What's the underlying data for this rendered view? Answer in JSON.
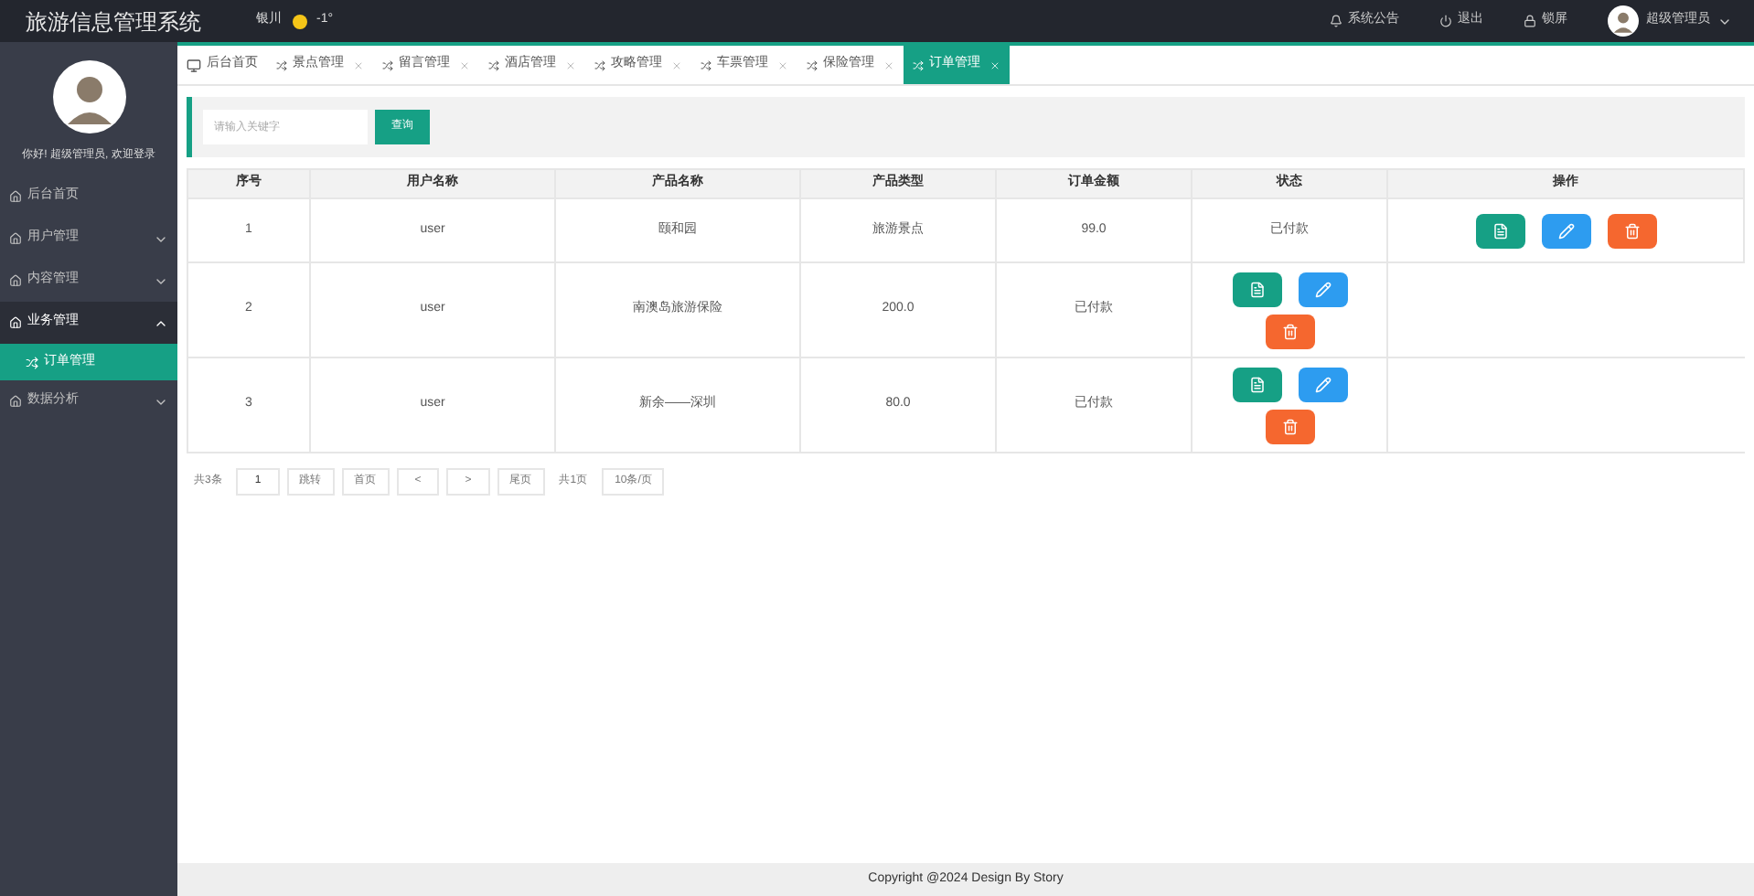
{
  "app_title": "旅游信息管理系统",
  "weather": {
    "city": "银川",
    "temperature": "-1°"
  },
  "header_links": [
    {
      "kind": "notice",
      "label": "系统公告"
    },
    {
      "kind": "logout",
      "label": "退出"
    },
    {
      "kind": "lock",
      "label": "锁屏"
    }
  ],
  "user": {
    "name": "超级管理员"
  },
  "sidebar": {
    "greeting": "你好! 超级管理员, 欢迎登录",
    "items": [
      {
        "label": "后台首页",
        "kind": "link",
        "selected": false
      },
      {
        "label": "用户管理",
        "kind": "group",
        "expanded": false,
        "selected": false
      },
      {
        "label": "内容管理",
        "kind": "group",
        "expanded": false,
        "selected": false
      },
      {
        "label": "业务管理",
        "kind": "group",
        "expanded": true,
        "selected": true,
        "children": [
          {
            "label": "订单管理",
            "selected": true
          }
        ]
      },
      {
        "label": "数据分析",
        "kind": "group",
        "expanded": false,
        "selected": false
      }
    ]
  },
  "tabs": [
    {
      "label": "后台首页",
      "kind": "home",
      "selected": false
    },
    {
      "label": "景点管理",
      "kind": "page",
      "selected": false
    },
    {
      "label": "留言管理",
      "kind": "page",
      "selected": false
    },
    {
      "label": "酒店管理",
      "kind": "page",
      "selected": false
    },
    {
      "label": "攻略管理",
      "kind": "page",
      "selected": false
    },
    {
      "label": "车票管理",
      "kind": "page",
      "selected": false
    },
    {
      "label": "保险管理",
      "kind": "page",
      "selected": false
    },
    {
      "label": "订单管理",
      "kind": "page",
      "selected": true
    }
  ],
  "search": {
    "placeholder": "请输入关键字",
    "button": "查询"
  },
  "table": {
    "columns": [
      "序号",
      "用户名称",
      "产品名称",
      "产品类型",
      "订单金额",
      "状态",
      "操作"
    ],
    "rows": [
      {
        "cells": [
          "1",
          "user",
          "颐和园",
          "旅游景点",
          "99.0",
          "已付款"
        ],
        "actions": [
          {
            "kind": "view"
          },
          {
            "kind": "edit"
          },
          {
            "kind": "delete"
          }
        ]
      },
      {
        "cells": [
          "2",
          "user",
          "南澳岛旅游保险",
          "200.0",
          "已付款"
        ],
        "actions": [
          {
            "kind": "view"
          },
          {
            "kind": "edit"
          },
          {
            "kind": "delete"
          }
        ]
      },
      {
        "cells": [
          "3",
          "user",
          "新余——深圳",
          "80.0",
          "已付款"
        ],
        "actions": [
          {
            "kind": "view"
          },
          {
            "kind": "edit"
          },
          {
            "kind": "delete"
          }
        ]
      }
    ]
  },
  "pagination": {
    "total": "共3条",
    "page": "1",
    "jump": "跳转",
    "first": "首页",
    "prev": "<",
    "next": ">",
    "last": "尾页",
    "pages": "共1页",
    "size": "10条/页"
  },
  "footer": "Copyright @2024 Design By Story"
}
